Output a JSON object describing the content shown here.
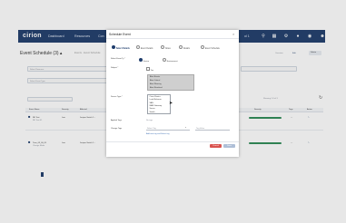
{
  "nav": {
    "logo": "cirion",
    "links": [
      "Dashboard",
      "Resources",
      "Con"
    ],
    "search_text": "ol 1",
    "icons": [
      "search-icon",
      "apps-icon",
      "gear-icon",
      "bell-icon",
      "user-icon"
    ]
  },
  "page": {
    "title": "Event Schedule (3) ▴",
    "subtitle": "Events · Event Schedule",
    "filters": [
      "Select Resource",
      "Select Event Type"
    ],
    "right_controls": [
      "Overview",
      "Edit",
      "Delete"
    ],
    "table_headers": [
      "Event Name",
      "Severity",
      "Affected"
    ],
    "rows": [
      {
        "name": "ND Test",
        "sub": "ND Test 01",
        "severity": "Low",
        "resource": "Juniper Switch 1..."
      },
      {
        "name": "Time_03_06_09",
        "sub": "Change Mode",
        "severity": "Low",
        "resource": "Juniper Switch 1..."
      }
    ]
  },
  "modal": {
    "title": "Schedule Event",
    "close": "×",
    "tabs": [
      "Select Details",
      "Event Details",
      "Notes",
      "Details",
      "Event Schedule"
    ],
    "fields": {
      "source_type_label": "Select Event Ty *",
      "source_type_options": [
        "Device",
        "Environment"
      ],
      "inherit_label": "Subject *",
      "inherit_value": "Yes",
      "listbox_items": [
        "Alert Events",
        "Alert Critical",
        "Alert Warning",
        "Alert Resolved"
      ],
      "device_type_label": "Device Type *",
      "device_type_items": [
        "Cisco Router",
        "Load Balancer",
        "SAN",
        "WAN Gateway",
        "Server",
        "Switch"
      ],
      "applied_tags_label": "Applied Tags",
      "applied_tags_value": "No tags",
      "change_tags_label": "Change Tags",
      "change_tags_placeholder": "Select Tag",
      "tag_value_placeholder": "Tag Value",
      "link_text": "Add new tag and Select tag"
    },
    "buttons": {
      "cancel": "Cancel",
      "save": "Save"
    }
  }
}
